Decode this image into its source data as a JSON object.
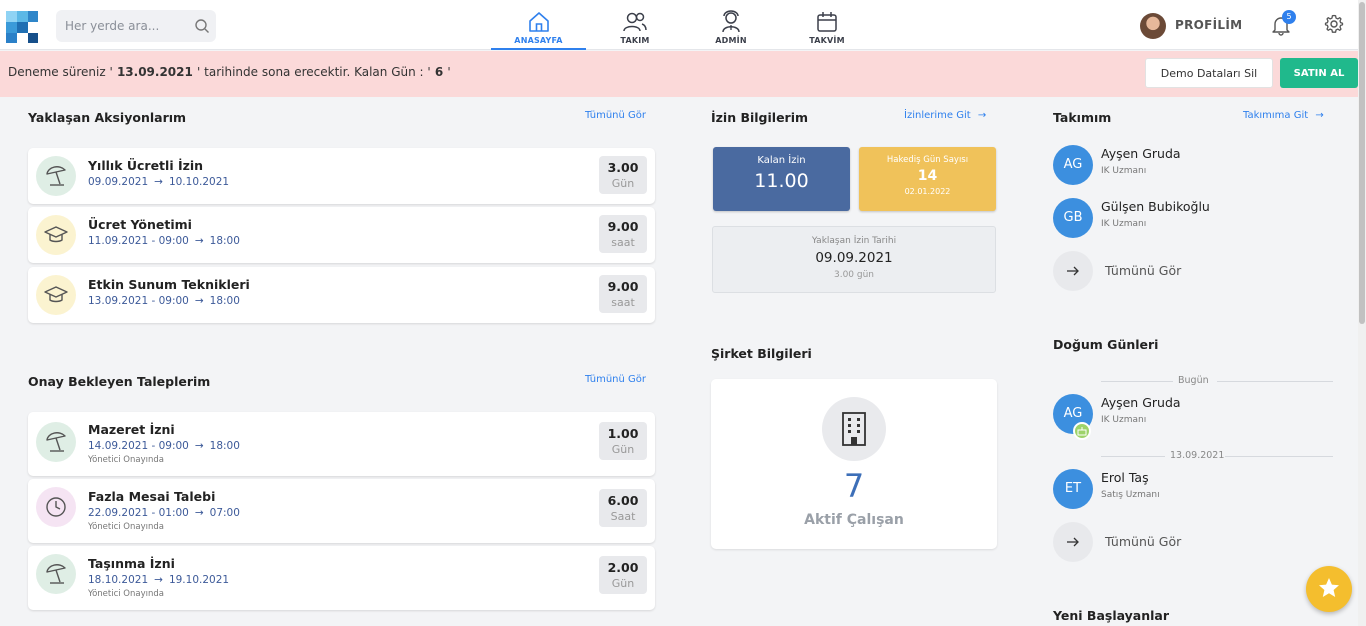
{
  "search": {
    "placeholder": "Her yerde ara..."
  },
  "nav": [
    {
      "label": "ANASAYFA",
      "icon": "home-icon",
      "active": true
    },
    {
      "label": "TAKIM",
      "icon": "team-icon"
    },
    {
      "label": "ADMİN",
      "icon": "admin-icon"
    },
    {
      "label": "TAKVİM",
      "icon": "calendar-icon"
    }
  ],
  "profile": {
    "label": "PROFİLİM"
  },
  "notifications": {
    "count": "5"
  },
  "banner": {
    "prefix": "Deneme süreniz '",
    "date": " 13.09.2021 ",
    "middle": "' tarihinde sona erecektir. Kalan Gün : '",
    "days": " 6 ",
    "suffix": "'",
    "demo_button": "Demo Dataları Sil",
    "buy_button": "SATIN AL"
  },
  "actions": {
    "title": "Yaklaşan Aksiyonlarım",
    "link": "Tümünü Gör",
    "items": [
      {
        "title": "Yıllık Ücretli İzin",
        "start": "09.09.2021",
        "end": "10.10.2021",
        "qty": "3.00",
        "unit": "Gün"
      },
      {
        "title": "Ücret Yönetimi",
        "start": "11.09.2021 - 09:00",
        "end": "18:00",
        "qty": "9.00",
        "unit": "saat"
      },
      {
        "title": "Etkin Sunum Teknikleri",
        "start": "13.09.2021 - 09:00",
        "end": "18:00",
        "qty": "9.00",
        "unit": "saat"
      }
    ]
  },
  "requests": {
    "title": "Onay Bekleyen Taleplerim",
    "link": "Tümünü Gör",
    "items": [
      {
        "title": "Mazeret İzni",
        "start": "14.09.2021 - 09:00",
        "end": "18:00",
        "status": "Yönetici Onayında",
        "qty": "1.00",
        "unit": "Gün"
      },
      {
        "title": "Fazla Mesai Talebi",
        "start": "22.09.2021 - 01:00",
        "end": "07:00",
        "status": "Yönetici Onayında",
        "qty": "6.00",
        "unit": "Saat"
      },
      {
        "title": "Taşınma İzni",
        "start": "18.10.2021",
        "end": "19.10.2021",
        "status": "Yönetici Onayında",
        "qty": "2.00",
        "unit": "Gün"
      }
    ]
  },
  "leave": {
    "title": "İzin Bilgilerim",
    "link": "İzinlerime Git",
    "remaining_label": "Kalan İzin",
    "remaining_value": "11.00",
    "earned_label": "Hakediş Gün Sayısı",
    "earned_value": "14",
    "earned_date": "02.01.2022",
    "upcoming_label": "Yaklaşan İzin Tarihi",
    "upcoming_date": "09.09.2021",
    "upcoming_days": "3.00 gün"
  },
  "company": {
    "title": "Şirket Bilgileri",
    "count": "7",
    "count_label": "Aktif Çalışan"
  },
  "team": {
    "title": "Takımım",
    "link": "Takımıma Git",
    "members": [
      {
        "initials": "AG",
        "name": "Ayşen Gruda",
        "role": "IK Uzmanı"
      },
      {
        "initials": "GB",
        "name": "Gülşen Bubikoğlu",
        "role": "IK Uzmanı"
      }
    ],
    "more": "Tümünü Gör"
  },
  "birthdays": {
    "title": "Doğum Günleri",
    "today_label": "Bugün",
    "today": {
      "initials": "AG",
      "name": "Ayşen Gruda",
      "role": "IK Uzmanı"
    },
    "next_date": "13.09.2021",
    "next": {
      "initials": "ET",
      "name": "Erol Taş",
      "role": "Satış Uzmanı"
    },
    "more": "Tümünü Gör"
  },
  "new_starters": {
    "title": "Yeni Başlayanlar"
  },
  "colors": {
    "accent": "#2f80ed",
    "banner_bg": "#fbd9d9",
    "buy_button": "#20b98c",
    "remaining_box": "#4a6aa0",
    "earned_box": "#f0c25a",
    "avatar": "#3c8fdf",
    "fab": "#f4be2e"
  }
}
